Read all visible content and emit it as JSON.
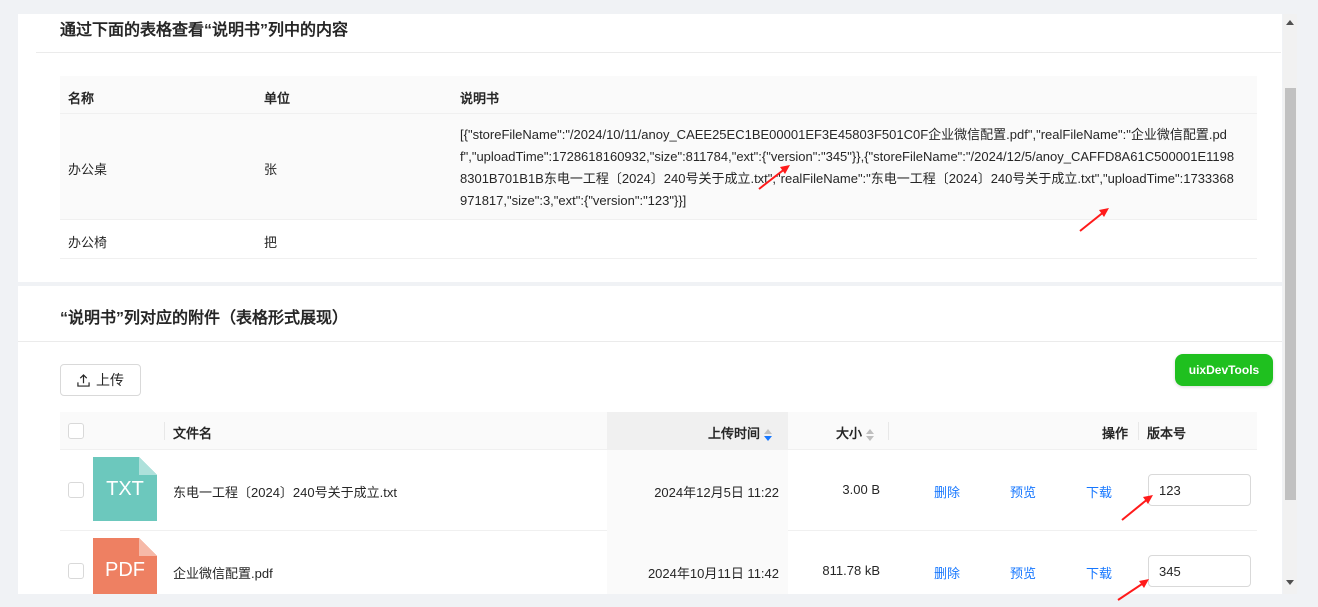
{
  "section1": {
    "title": "通过下面的表格查看“说明书”列中的内容",
    "headers": [
      "名称",
      "单位",
      "说明书"
    ],
    "rows": [
      {
        "name": "办公桌",
        "unit": "张",
        "desc": "[{\"storeFileName\":\"/2024/10/11/anoy_CAEE25EC1BE00001EF3E45803F501C0F企业微信配置.pdf\",\"realFileName\":\"企业微信配置.pdf\",\"uploadTime\":1728618160932,\"size\":811784,\"ext\":{\"version\":\"345\"}},{\"storeFileName\":\"/2024/12/5/anoy_CAFFD8A61C500001E11988301B701B1B东电一工程〔2024〕240号关于成立.txt\",\"realFileName\":\"东电一工程〔2024〕240号关于成立.txt\",\"uploadTime\":1733368971817,\"size\":3,\"ext\":{\"version\":\"123\"}}]"
      },
      {
        "name": "办公椅",
        "unit": "把",
        "desc": ""
      }
    ]
  },
  "section2": {
    "title": "“说明书”列对应的附件（表格形式展现）",
    "upload_label": "上传",
    "devtools_label": "uixDevTools",
    "headers": {
      "filename": "文件名",
      "upload_time": "上传时间",
      "size": "大小",
      "actions": "操作",
      "version": "版本号"
    },
    "files": [
      {
        "icon_text": "TXT",
        "name": "东电一工程〔2024〕240号关于成立.txt",
        "time": "2024年12月5日 11:22",
        "size": "3.00 B",
        "delete": "删除",
        "preview": "预览",
        "download": "下载",
        "version": "123"
      },
      {
        "icon_text": "PDF",
        "name": "企业微信配置.pdf",
        "time": "2024年10月11日 11:42",
        "size": "811.78 kB",
        "delete": "删除",
        "preview": "预览",
        "download": "下载",
        "version": "345"
      }
    ]
  },
  "colors": {
    "link": "#1677ff",
    "devtools": "#1fc01f",
    "txt_icon": "#6cc8bd",
    "pdf_icon": "#ee8062",
    "annotation_arrow": "#ff1a1a"
  }
}
